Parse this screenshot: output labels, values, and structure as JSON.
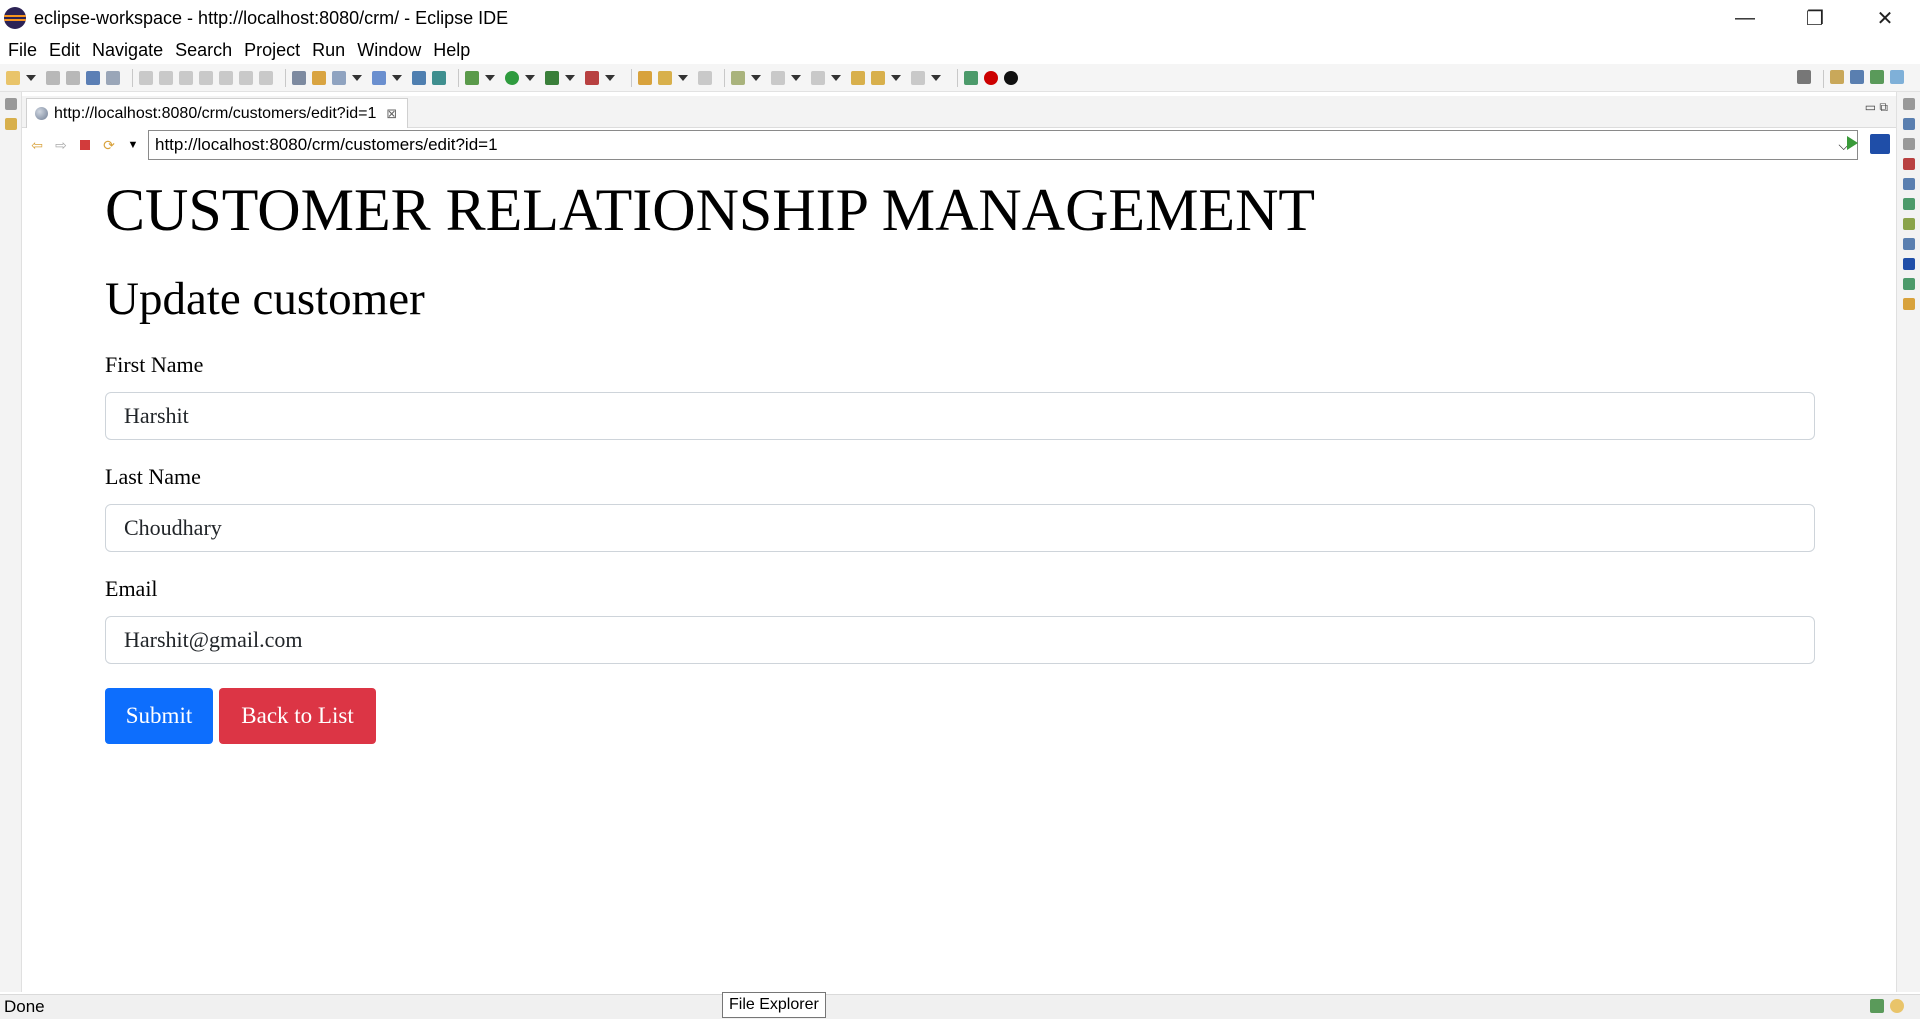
{
  "window": {
    "title": "eclipse-workspace - http://localhost:8080/crm/ - Eclipse IDE",
    "controls": {
      "minimize": "—",
      "restore": "❐",
      "close": "✕"
    }
  },
  "menu": [
    "File",
    "Edit",
    "Navigate",
    "Search",
    "Project",
    "Run",
    "Window",
    "Help"
  ],
  "editor": {
    "tab_label": "http://localhost:8080/crm/customers/edit?id=1",
    "tab_close": "⊠"
  },
  "browser": {
    "url": "http://localhost:8080/crm/customers/edit?id=1"
  },
  "page": {
    "heading": "CUSTOMER RELATIONSHIP MANAGEMENT",
    "subheading": "Update customer",
    "form": {
      "first_name_label": "First Name",
      "first_name_value": "Harshit",
      "last_name_label": "Last Name",
      "last_name_value": "Choudhary",
      "email_label": "Email",
      "email_value": "Harshit@gmail.com",
      "submit_label": "Submit",
      "back_label": "Back to List"
    }
  },
  "status": {
    "text": "Done",
    "tooltip": "File Explorer"
  },
  "colors": {
    "submit": "#0d6efd",
    "back": "#dc3545"
  }
}
